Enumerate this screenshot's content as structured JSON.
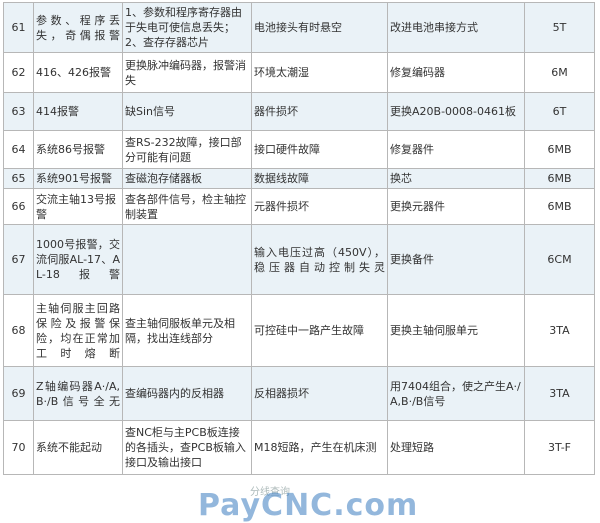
{
  "rows": [
    {
      "num": "61",
      "alarm": "参数、程序丢失，奇偶报警",
      "check": "1、参数和程序寄存器由于失电可使信息丢失；2、查存存器芯片",
      "cause": "电池接头有时悬空",
      "fix": "改进电池串接方式",
      "code": "5T"
    },
    {
      "num": "62",
      "alarm": "416、426报警",
      "check": "更换脉冲编码器，报警消失",
      "cause": "环境太潮湿",
      "fix": "修复编码器",
      "code": "6M"
    },
    {
      "num": "63",
      "alarm": "414报警",
      "check": "缺Sin信号",
      "cause": "器件损坏",
      "fix": "更换A20B-0008-0461板",
      "code": "6T"
    },
    {
      "num": "64",
      "alarm": "系统86号报警",
      "check": "查RS-232故障，接口部分可能有问题",
      "cause": "接口硬件故障",
      "fix": "修复器件",
      "code": "6MB"
    },
    {
      "num": "65",
      "alarm": "系统901号报警",
      "check": "查磁泡存储器板",
      "cause": "数据线故障",
      "fix": "换芯",
      "code": "6MB"
    },
    {
      "num": "66",
      "alarm": "交流主轴13号报警",
      "check": "查各部件信号，检主轴控制装置",
      "cause": "元器件损坏",
      "fix": "更换元器件",
      "code": "6MB"
    },
    {
      "num": "67",
      "alarm": "1000号报警，交流伺服AL-17、AL-18报警",
      "check": "",
      "cause": "输入电压过高（450V），稳压器自动控制失灵",
      "fix": "更换备件",
      "code": "6CM"
    },
    {
      "num": "68",
      "alarm": "主轴伺服主回路保险及报警保险，均在正常加工时熔断",
      "check": "查主轴伺服板单元及相隔，找出连线部分",
      "cause": "可控硅中一路产生故障",
      "fix": "更换主轴伺服单元",
      "code": "3TA"
    },
    {
      "num": "69",
      "alarm": "Z轴编码器A·/A,B·/B信号全无",
      "check": "查编码器内的反相器",
      "cause": "反相器损坏",
      "fix": "用7404组合，使之产生A·/A,B·/B信号",
      "code": "3TA"
    },
    {
      "num": "70",
      "alarm": "系统不能起动",
      "check": "查NC柜与主PCB板连接的各插头，查PCB板输入接口及输出接口",
      "cause": "M18短路，产生在机床测",
      "fix": "处理短路",
      "code": "3T-F"
    }
  ],
  "watermark": {
    "brand": "PayCNC.com",
    "sub": "分线查询"
  }
}
